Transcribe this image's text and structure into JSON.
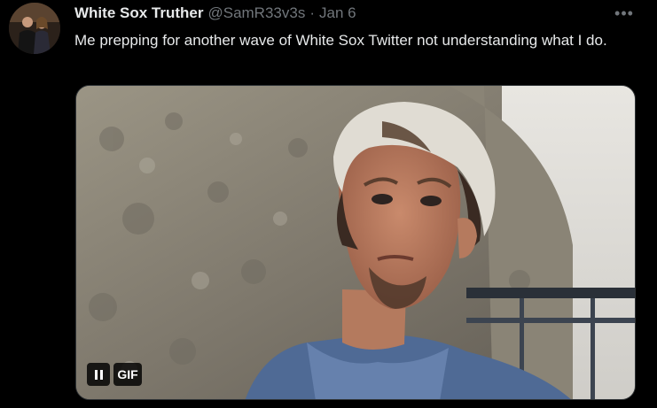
{
  "tweet": {
    "display_name": "White Sox Truther",
    "handle": "@SamR33v3s",
    "separator": "·",
    "date": "Jan 6",
    "more_icon": "more-horizontal-icon",
    "more_label": "•••",
    "text": "Me prepping for another wave of White Sox Twitter not understanding what I do."
  },
  "media": {
    "type": "gif",
    "gif_label": "GIF",
    "pause_icon": "pause-icon"
  },
  "colors": {
    "background": "#000000",
    "primary_text": "#e7e9ea",
    "secondary_text": "#71767b",
    "border": "#2f3336"
  }
}
